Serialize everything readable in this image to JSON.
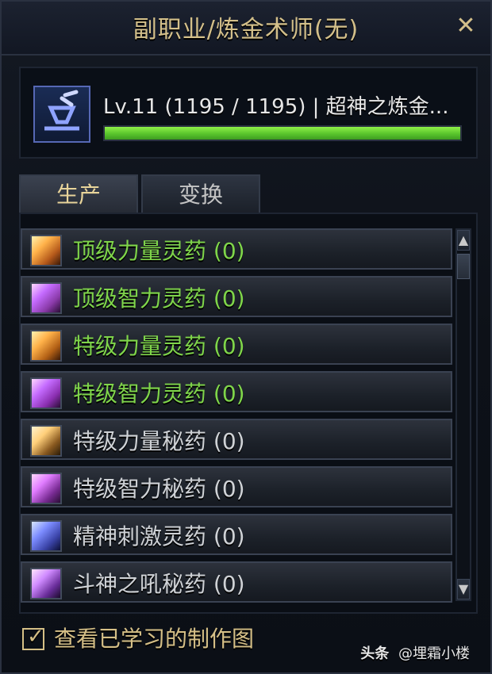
{
  "window": {
    "title": "副职业/炼金术师(无)",
    "close_icon": "close-icon"
  },
  "header": {
    "level_text": "Lv.11 (1195 / 1195) | 超神之炼金...",
    "progress_fraction": 1.0,
    "avatar_icon": "alchemy-icon"
  },
  "tabs": [
    {
      "label": "生产",
      "active": true
    },
    {
      "label": "变换",
      "active": false
    }
  ],
  "recipes": [
    {
      "label": "顶级力量灵药 (0)",
      "color": "#7fd54a",
      "icon": "potion-icon",
      "icon_color": "#b65a1b"
    },
    {
      "label": "顶级智力灵药 (0)",
      "color": "#7fd54a",
      "icon": "potion-icon",
      "icon_color": "#8a3aa8"
    },
    {
      "label": "特级力量灵药 (0)",
      "color": "#7fd54a",
      "icon": "potion-icon",
      "icon_color": "#b46116"
    },
    {
      "label": "特级智力灵药 (0)",
      "color": "#7fd54a",
      "icon": "potion-icon",
      "icon_color": "#8b2fb0"
    },
    {
      "label": "特级力量秘药 (0)",
      "color": "#cfd2d6",
      "icon": "potion-icon",
      "icon_color": "#8a5a20"
    },
    {
      "label": "特级智力秘药 (0)",
      "color": "#cfd2d6",
      "icon": "potion-icon",
      "icon_color": "#7a2c95"
    },
    {
      "label": "精神刺激灵药 (0)",
      "color": "#cfd2d6",
      "icon": "potion-icon",
      "icon_color": "#3b44a8"
    },
    {
      "label": "斗神之吼秘药 (0)",
      "color": "#cfd2d6",
      "icon": "potion-icon",
      "icon_color": "#6a2e9b"
    }
  ],
  "scrollbar": {
    "up_icon": "chevron-up-icon",
    "down_icon": "chevron-down-icon"
  },
  "footer": {
    "checkbox_checked": true,
    "label": "查看已学习的制作图"
  },
  "watermark": {
    "left": "头条",
    "right": "@埋霜小楼"
  },
  "colors": {
    "gold": "#d4c08a",
    "green": "#7fd54a",
    "white": "#cfd2d6"
  }
}
